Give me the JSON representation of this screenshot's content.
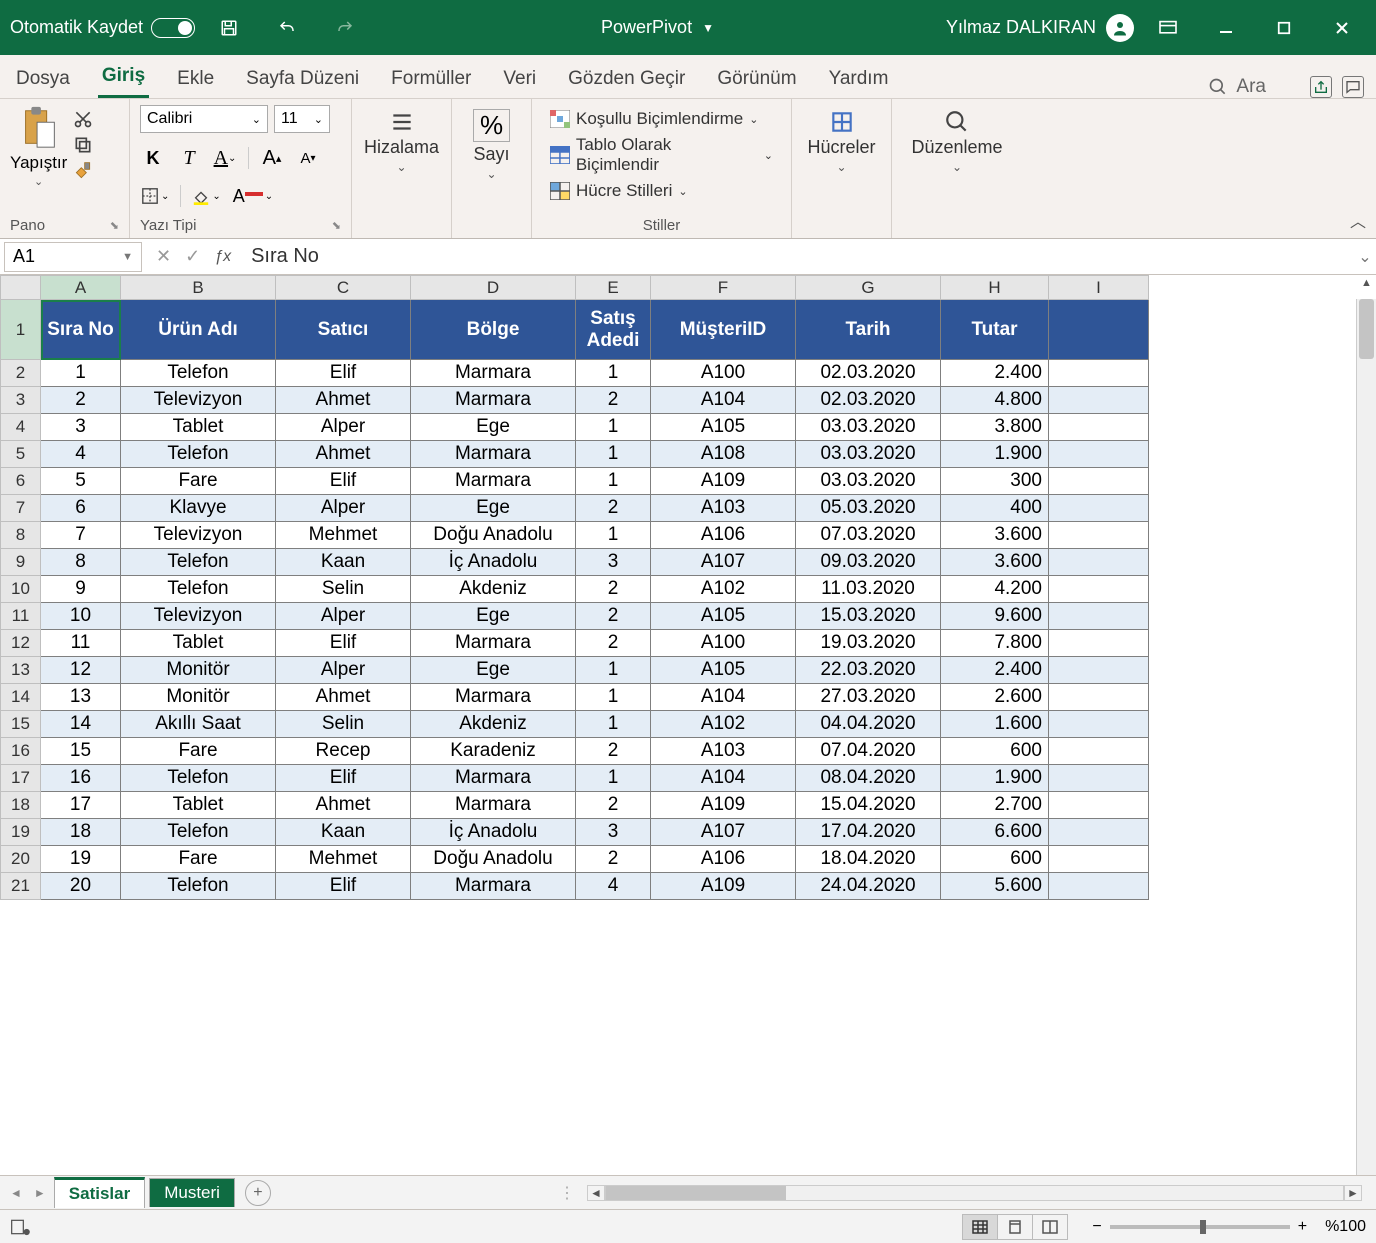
{
  "titlebar": {
    "autosave": "Otomatik Kaydet",
    "app_title": "PowerPivot",
    "user": "Yılmaz DALKIRAN"
  },
  "tabs": {
    "file": "Dosya",
    "home": "Giriş",
    "insert": "Ekle",
    "layout": "Sayfa Düzeni",
    "formulas": "Formüller",
    "data": "Veri",
    "review": "Gözden Geçir",
    "view": "Görünüm",
    "help": "Yardım",
    "search": "Ara"
  },
  "ribbon": {
    "clipboard": {
      "paste": "Yapıştır",
      "group": "Pano"
    },
    "font": {
      "name": "Calibri",
      "size": "11",
      "group": "Yazı Tipi"
    },
    "align": {
      "label": "Hizalama"
    },
    "number": {
      "label": "Sayı"
    },
    "styles": {
      "cond": "Koşullu Biçimlendirme",
      "table": "Tablo Olarak Biçimlendir",
      "cell": "Hücre Stilleri",
      "group": "Stiller"
    },
    "cells": {
      "label": "Hücreler"
    },
    "editing": {
      "label": "Düzenleme"
    }
  },
  "formulabar": {
    "ref": "A1",
    "value": "Sıra No"
  },
  "columns": [
    "A",
    "B",
    "C",
    "D",
    "E",
    "F",
    "G",
    "H",
    "I"
  ],
  "headers": {
    "sira": "Sıra No",
    "urun": "Ürün Adı",
    "satici": "Satıcı",
    "bolge": "Bölge",
    "adet": "Satış Adedi",
    "mid": "MüşteriID",
    "tarih": "Tarih",
    "tutar": "Tutar"
  },
  "rows": [
    {
      "n": "1",
      "u": "Telefon",
      "s": "Elif",
      "b": "Marmara",
      "a": "1",
      "m": "A100",
      "t": "02.03.2020",
      "tu": "2.400"
    },
    {
      "n": "2",
      "u": "Televizyon",
      "s": "Ahmet",
      "b": "Marmara",
      "a": "2",
      "m": "A104",
      "t": "02.03.2020",
      "tu": "4.800"
    },
    {
      "n": "3",
      "u": "Tablet",
      "s": "Alper",
      "b": "Ege",
      "a": "1",
      "m": "A105",
      "t": "03.03.2020",
      "tu": "3.800"
    },
    {
      "n": "4",
      "u": "Telefon",
      "s": "Ahmet",
      "b": "Marmara",
      "a": "1",
      "m": "A108",
      "t": "03.03.2020",
      "tu": "1.900"
    },
    {
      "n": "5",
      "u": "Fare",
      "s": "Elif",
      "b": "Marmara",
      "a": "1",
      "m": "A109",
      "t": "03.03.2020",
      "tu": "300"
    },
    {
      "n": "6",
      "u": "Klavye",
      "s": "Alper",
      "b": "Ege",
      "a": "2",
      "m": "A103",
      "t": "05.03.2020",
      "tu": "400"
    },
    {
      "n": "7",
      "u": "Televizyon",
      "s": "Mehmet",
      "b": "Doğu Anadolu",
      "a": "1",
      "m": "A106",
      "t": "07.03.2020",
      "tu": "3.600"
    },
    {
      "n": "8",
      "u": "Telefon",
      "s": "Kaan",
      "b": "İç Anadolu",
      "a": "3",
      "m": "A107",
      "t": "09.03.2020",
      "tu": "3.600"
    },
    {
      "n": "9",
      "u": "Telefon",
      "s": "Selin",
      "b": "Akdeniz",
      "a": "2",
      "m": "A102",
      "t": "11.03.2020",
      "tu": "4.200"
    },
    {
      "n": "10",
      "u": "Televizyon",
      "s": "Alper",
      "b": "Ege",
      "a": "2",
      "m": "A105",
      "t": "15.03.2020",
      "tu": "9.600"
    },
    {
      "n": "11",
      "u": "Tablet",
      "s": "Elif",
      "b": "Marmara",
      "a": "2",
      "m": "A100",
      "t": "19.03.2020",
      "tu": "7.800"
    },
    {
      "n": "12",
      "u": "Monitör",
      "s": "Alper",
      "b": "Ege",
      "a": "1",
      "m": "A105",
      "t": "22.03.2020",
      "tu": "2.400"
    },
    {
      "n": "13",
      "u": "Monitör",
      "s": "Ahmet",
      "b": "Marmara",
      "a": "1",
      "m": "A104",
      "t": "27.03.2020",
      "tu": "2.600"
    },
    {
      "n": "14",
      "u": "Akıllı Saat",
      "s": "Selin",
      "b": "Akdeniz",
      "a": "1",
      "m": "A102",
      "t": "04.04.2020",
      "tu": "1.600"
    },
    {
      "n": "15",
      "u": "Fare",
      "s": "Recep",
      "b": "Karadeniz",
      "a": "2",
      "m": "A103",
      "t": "07.04.2020",
      "tu": "600"
    },
    {
      "n": "16",
      "u": "Telefon",
      "s": "Elif",
      "b": "Marmara",
      "a": "1",
      "m": "A104",
      "t": "08.04.2020",
      "tu": "1.900"
    },
    {
      "n": "17",
      "u": "Tablet",
      "s": "Ahmet",
      "b": "Marmara",
      "a": "2",
      "m": "A109",
      "t": "15.04.2020",
      "tu": "2.700"
    },
    {
      "n": "18",
      "u": "Telefon",
      "s": "Kaan",
      "b": "İç Anadolu",
      "a": "3",
      "m": "A107",
      "t": "17.04.2020",
      "tu": "6.600"
    },
    {
      "n": "19",
      "u": "Fare",
      "s": "Mehmet",
      "b": "Doğu Anadolu",
      "a": "2",
      "m": "A106",
      "t": "18.04.2020",
      "tu": "600"
    },
    {
      "n": "20",
      "u": "Telefon",
      "s": "Elif",
      "b": "Marmara",
      "a": "4",
      "m": "A109",
      "t": "24.04.2020",
      "tu": "5.600"
    }
  ],
  "sheets": {
    "active": "Satislar",
    "other": "Musteri"
  },
  "status": {
    "zoom": "%100"
  }
}
